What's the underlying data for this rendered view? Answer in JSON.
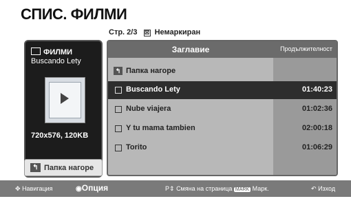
{
  "header": {
    "title": "СПИС. ФИЛМИ"
  },
  "page_info": {
    "page": "Стр. 2/3",
    "filter": "Немаркиран"
  },
  "preview": {
    "category": "ФИЛМИ",
    "file_name": "Buscando Lety",
    "resolution": "720x576, 120KB",
    "up_button": "Папка нагоре"
  },
  "list": {
    "columns": {
      "title": "Заглавие",
      "duration": "Продължителност"
    },
    "up_row": "Папка нагоре",
    "items": [
      {
        "name": "Buscando Lety",
        "duration": "01:40:23",
        "selected": true
      },
      {
        "name": "Nube viajera",
        "duration": "01:02:36"
      },
      {
        "name": "Y tu mama tambien",
        "duration": "02:00:18"
      },
      {
        "name": "Torito",
        "duration": "01:06:29"
      }
    ]
  },
  "footer": {
    "navigation": "Навигация",
    "option": "Опция",
    "page_change": "Смяна на страница",
    "mark_key": "MARK",
    "mark": "Марк.",
    "exit": "Изход"
  }
}
